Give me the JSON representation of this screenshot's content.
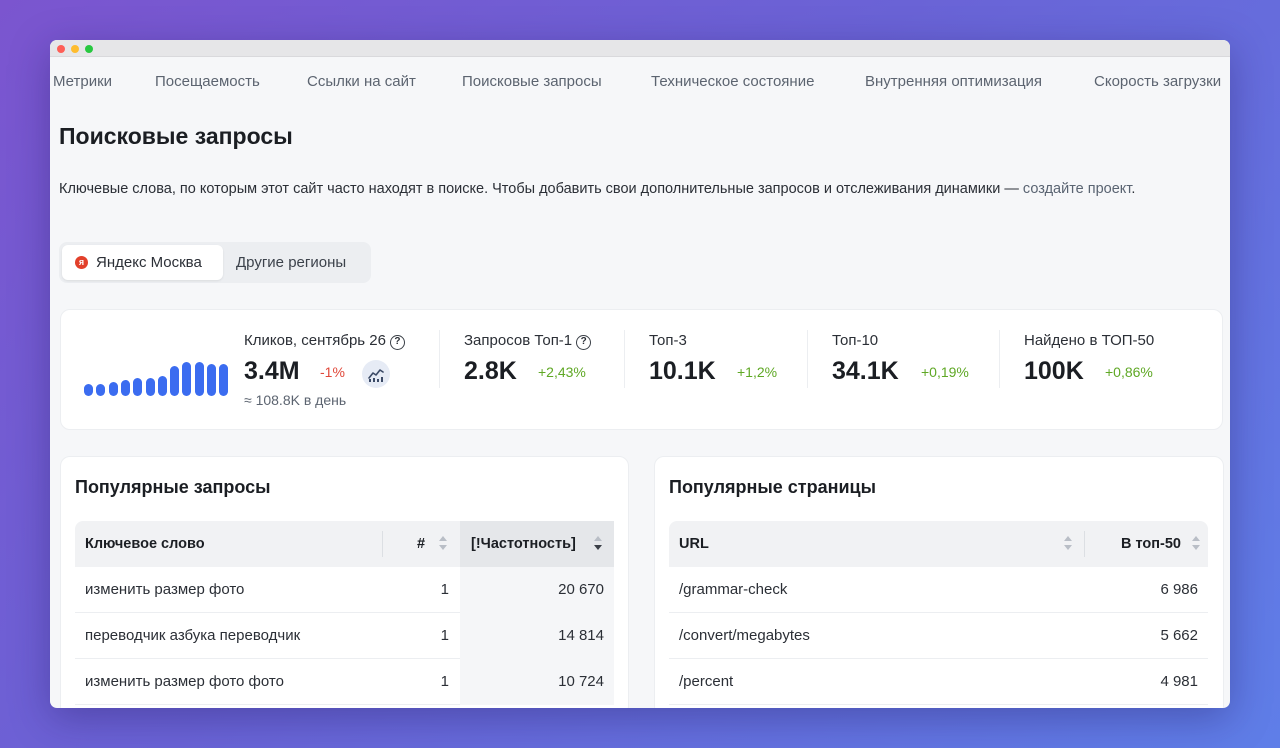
{
  "nav": {
    "items": [
      "Метрики",
      "Посещаемость",
      "Ссылки на сайт",
      "Поисковые запросы",
      "Техническое состояние",
      "Внутренняя оптимизация",
      "Скорость загрузки"
    ]
  },
  "page": {
    "title": "Поисковые запросы",
    "description": "Ключевые слова, по которым этот сайт часто находят в поиске. Чтобы добавить свои дополнительные запросов и отслеживания динамики — ",
    "description_link": "создайте проект",
    "description_end": "."
  },
  "regions": {
    "active": "Яндекс Москва",
    "active_icon": "я",
    "other": "Другие регионы"
  },
  "stats": {
    "clicks": {
      "label": "Кликов, сентябрь 26",
      "value": "3.4M",
      "delta": "-1%",
      "per_day": "≈ 108.8K в день",
      "trend": [
        6,
        6,
        7,
        8,
        9,
        9,
        10,
        15,
        17,
        17,
        16,
        16
      ]
    },
    "top1": {
      "label": "Запросов Топ-1",
      "value": "2.8K",
      "delta": "+2,43%"
    },
    "top3": {
      "label": "Топ-3",
      "value": "10.1K",
      "delta": "+1,2%"
    },
    "top10": {
      "label": "Топ-10",
      "value": "34.1K",
      "delta": "+0,19%"
    },
    "top50": {
      "label": "Найдено в ТОП-50",
      "value": "100K",
      "delta": "+0,86%"
    },
    "help_glyph": "?",
    "chart_icon": "line-chart-icon"
  },
  "popular_queries": {
    "title": "Популярные запросы",
    "columns": {
      "keyword": "Ключевое слово",
      "position": "#",
      "frequency": "[!Частотность]"
    },
    "rows": [
      {
        "keyword": "изменить размер фото",
        "position": "1",
        "frequency": "20 670"
      },
      {
        "keyword": "переводчик азбука переводчик",
        "position": "1",
        "frequency": "14 814"
      },
      {
        "keyword": "изменить размер фото фото",
        "position": "1",
        "frequency": "10 724"
      }
    ]
  },
  "popular_pages": {
    "title": "Популярные страницы",
    "columns": {
      "url": "URL",
      "top50": "В топ-50"
    },
    "rows": [
      {
        "url": "/grammar-check",
        "top50": "6 986"
      },
      {
        "url": "/convert/megabytes",
        "top50": "5 662"
      },
      {
        "url": "/percent",
        "top50": "4 981"
      }
    ]
  },
  "colors": {
    "accent": "#3b6cf0",
    "positive": "#5fa825",
    "negative": "#e0483a",
    "yandex": "#e2402b"
  }
}
